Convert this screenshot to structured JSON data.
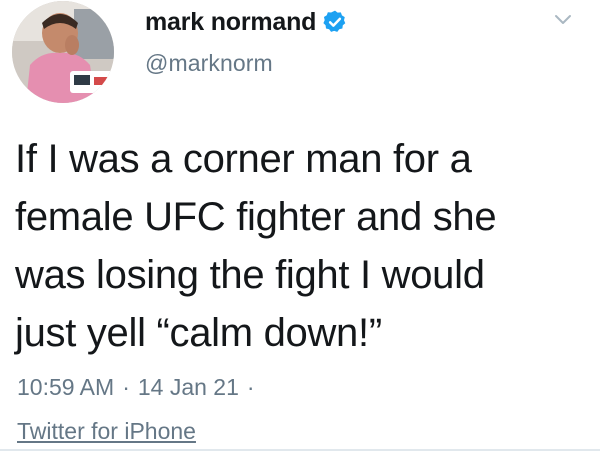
{
  "author": {
    "display_name": "mark normand",
    "handle": "@marknorm",
    "verified": true
  },
  "tweet": {
    "text_lines": [
      "If I was a corner man for a",
      "female UFC fighter and she",
      "was losing the fight I would",
      "just yell “calm down!”"
    ],
    "time": "10:59 AM",
    "date": "14 Jan 21",
    "separator": "·",
    "source": "Twitter for iPhone"
  },
  "icons": {
    "verified": "verified-badge-icon",
    "menu": "chevron-down-icon"
  },
  "colors": {
    "verified_blue": "#1da1f2",
    "secondary_text": "#657786",
    "primary_text": "#14171a"
  }
}
